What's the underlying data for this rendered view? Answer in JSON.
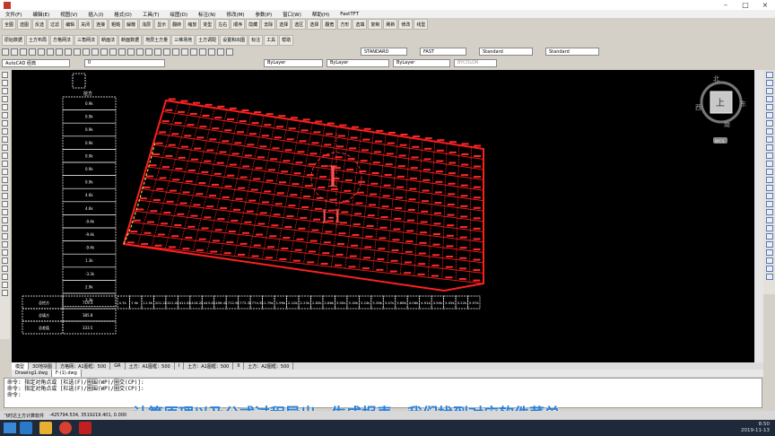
{
  "window": {
    "menus": [
      "文件(F)",
      "编辑(E)",
      "视图(V)",
      "插入(I)",
      "格式(O)",
      "工具(T)",
      "绘图(D)",
      "标注(N)",
      "修改(M)",
      "参数(P)",
      "窗口(W)",
      "帮助(H)",
      "FastTFT"
    ]
  },
  "ribbon_row1": [
    "全图",
    "选图",
    "反选",
    "过滤",
    "编辑",
    "关闭",
    "连接",
    "粗糙",
    "解散",
    "浅层",
    "显示",
    "翻转",
    "缩放",
    "变型",
    "左右",
    "顺序",
    "隐藏",
    "去除",
    "选择",
    "选区",
    "选择",
    "翻宽",
    "方形",
    "选填",
    "复制",
    "刷新",
    "修改",
    "线型"
  ],
  "ribbon_row2": [
    "原始数据",
    "土方布局",
    "方格网法",
    "三角网法",
    "断面法",
    "断面数据",
    "地层土方量",
    "三维场地",
    "土方调配",
    "设置和出图",
    "标注",
    "工具",
    "帮助"
  ],
  "styles": {
    "text_style": "STANDARD",
    "fast": "FAST",
    "dim_style": "Standard",
    "table_style": "Standard"
  },
  "workspace": "AutoCAD 经典",
  "layer": "0",
  "props": {
    "color": "ByLayer",
    "linetype": "ByLayer",
    "lineweight": "ByLayer",
    "plotstyle": "BYCOLOR"
  },
  "viewcube": {
    "center": "上",
    "north": "北",
    "south": "南",
    "east": "东",
    "west": "西",
    "wcs": "WCS"
  },
  "drawing_labels": {
    "region": "I",
    "section": "I-I"
  },
  "table": {
    "header": "挖方",
    "col_values": [
      "0.9k",
      "0.9k",
      "0.9k",
      "0.9k",
      "0.9k",
      "0.9k",
      "0.9k",
      "4.6k",
      "4.6k",
      "-9.4k",
      "-9.4k",
      "-9.4k",
      "1.3k",
      "-3.3k",
      "2.9k",
      "3.3k"
    ],
    "row_labels": [
      "总挖方",
      "总填方",
      "总差值"
    ],
    "row_values": [
      "719.3",
      "385.8",
      "333.5"
    ],
    "col_sums": [
      "4.7k",
      "7.9k",
      "11.5k",
      "201.2k",
      "411.0k",
      "411.8k",
      "416.2k",
      "443.4k",
      "456.4k",
      "712.9k",
      "773.3k",
      "774.5k",
      "1.79k",
      "1.99k",
      "2.10k",
      "2.23k",
      "2.83k",
      "2.86k",
      "3.00k",
      "3.18k",
      "3.24k",
      "3.38k",
      "3.47k",
      "3.88k",
      "4.06k",
      "4.91k",
      "4.94k",
      "5.05k",
      "5.22k",
      "5.97k"
    ]
  },
  "layout_tabs": [
    "模型",
    "3D地块图",
    "方格网：A1图框：500",
    "GR",
    "土方：A1图框：500",
    "I",
    "土方：A1图框：500",
    "II",
    "土方：A2图框：500"
  ],
  "file_tabs": [
    "Drawing1.dwg",
    "F-(1).dwg"
  ],
  "command_lines": [
    "命令: 指定对角点或 [栏选(F)/圈围(WP)/圈交(CP)]:",
    "命令: 指定对角点或 [栏选(F)/圈围(WP)/圈交(CP)]:",
    "命令:"
  ],
  "status": {
    "app": "飞时达土方计算软件",
    "coords": "-425794.534, 3519219.401, 0.000"
  },
  "subtitle": "计算原理以及公式过程导出、生成报表，我们找到对应软件菜单",
  "taskbar": {
    "time": "8:50",
    "date": "2019-11-13"
  },
  "colors": {
    "background": "#000000",
    "grid": "#ff1a1a",
    "table_line": "#ffffff",
    "subtitle": "#2a7fd4"
  }
}
